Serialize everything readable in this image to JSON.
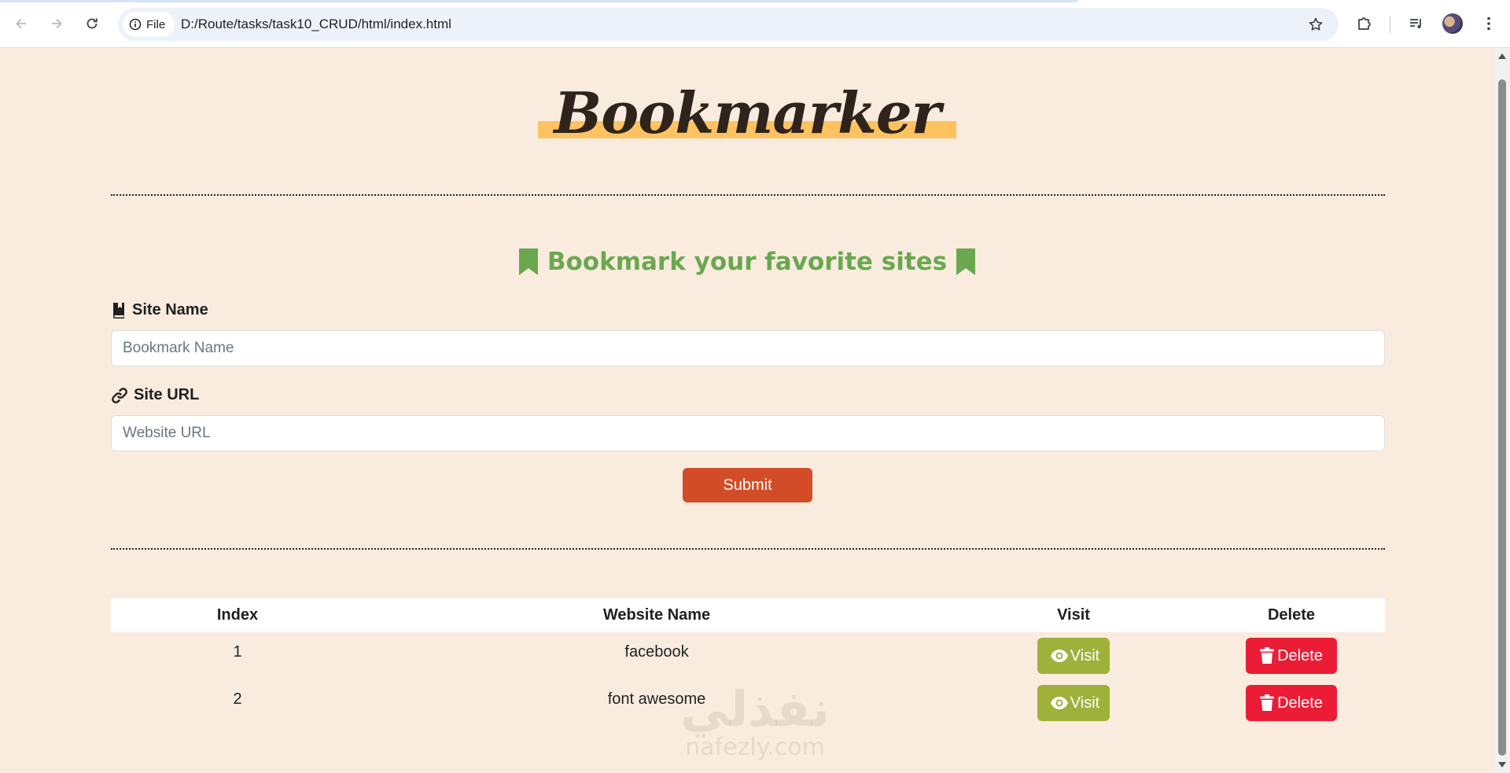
{
  "browser": {
    "chip_label": "File",
    "url": "D:/Route/tasks/task10_CRUD/html/index.html"
  },
  "header": {
    "logo_text": "Bookmarker"
  },
  "form": {
    "tagline": "Bookmark your favorite sites",
    "site_name_label": "Site Name",
    "site_name_placeholder": "Bookmark Name",
    "site_url_label": "Site URL",
    "site_url_placeholder": "Website URL",
    "submit_label": "Submit"
  },
  "table": {
    "headers": [
      "Index",
      "Website Name",
      "Visit",
      "Delete"
    ],
    "rows": [
      {
        "index": "1",
        "name": "facebook",
        "visit_label": "Visit",
        "delete_label": "Delete"
      },
      {
        "index": "2",
        "name": "font awesome",
        "visit_label": "Visit",
        "delete_label": "Delete"
      }
    ]
  },
  "watermark": {
    "arabic": "نفذلي",
    "latin": "nafezly.com"
  },
  "colors": {
    "page_bg": "#f9ecdf",
    "logo_highlight": "#fec260",
    "tagline_green": "#6aa84f",
    "submit_orange": "#d24d27",
    "visit_green": "#9eb23b",
    "delete_red": "#eb1d36"
  },
  "icons": {
    "back": "arrow-left-icon",
    "forward": "arrow-right-icon",
    "reload": "reload-icon",
    "info": "info-icon",
    "star": "star-icon",
    "extensions": "puzzle-icon",
    "media": "media-queue-icon",
    "menu": "kebab-menu-icon",
    "bookmark": "bookmark-icon",
    "book": "book-bookmark-icon",
    "link": "link-icon",
    "eye": "eye-icon",
    "trash": "trash-icon"
  }
}
